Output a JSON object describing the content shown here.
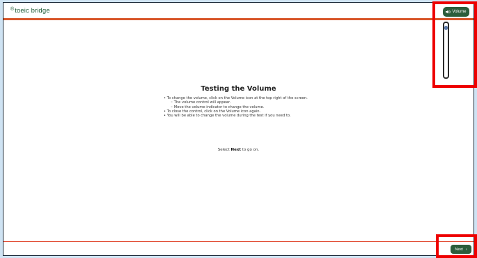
{
  "header": {
    "logo_mark": "®",
    "logo_text": "toeic bridge",
    "volume_label": "Volume"
  },
  "volume_control": {
    "level": 0.95
  },
  "main": {
    "title": "Testing the Volume",
    "instructions": [
      "To change the volume, click on the Volume icon at the top right of the screen.",
      "The volume control will appear.",
      "Move the volume indicator to change the volume.",
      "To close the control, click on the Volume icon again.",
      "You will be able to change the volume during the test if you need to."
    ],
    "select_prefix": "Select ",
    "select_bold": "Next",
    "select_suffix": " to go on."
  },
  "footer": {
    "next_label": "Next",
    "next_glyph": "›"
  },
  "colors": {
    "brand_green": "#2b5d3b",
    "accent_orange": "#d8562a",
    "highlight_red": "#ee0000"
  }
}
